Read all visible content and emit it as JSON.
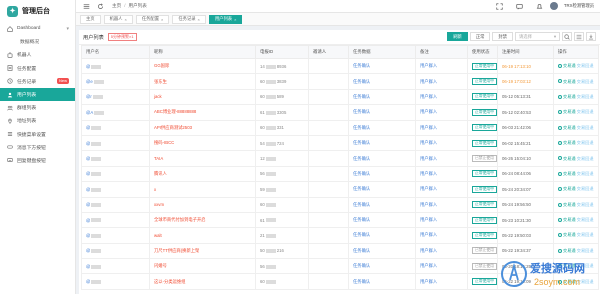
{
  "app": {
    "title": "管理后台",
    "logo_glyph": "✦"
  },
  "sidebar": {
    "items": [
      {
        "label": "Dashboard",
        "icon": "home-icon",
        "caret": "▾",
        "type": "parent"
      },
      {
        "label": "数据概况",
        "icon": "",
        "type": "sub"
      },
      {
        "label": "机器人",
        "icon": "robot-icon",
        "type": "item"
      },
      {
        "label": "任务配置",
        "icon": "task-icon",
        "type": "item"
      },
      {
        "label": "任务记录",
        "icon": "record-icon",
        "badge": "New",
        "type": "item"
      },
      {
        "label": "用户列表",
        "icon": "user-icon",
        "type": "active"
      },
      {
        "label": "群组列表",
        "icon": "group-icon",
        "type": "item"
      },
      {
        "label": "地址列表",
        "icon": "address-icon",
        "type": "item"
      },
      {
        "label": "快捷菜单设置",
        "icon": "menu-icon",
        "type": "item"
      },
      {
        "label": "消息下方按钮",
        "icon": "button-icon",
        "type": "item"
      },
      {
        "label": "回复键盘按钮",
        "icon": "keyboard-icon",
        "type": "item"
      }
    ]
  },
  "topbar": {
    "breadcrumb": [
      "主页",
      "用户列表"
    ],
    "user": "TRX检测管理员",
    "icons": [
      "menu-icon",
      "refresh-icon",
      "fullscreen-icon",
      "message-icon",
      "bell-icon"
    ]
  },
  "tabs": [
    {
      "label": "主页",
      "active": false
    },
    {
      "label": "机器人",
      "active": false
    },
    {
      "label": "任务配置",
      "active": false
    },
    {
      "label": "任务记录",
      "active": false
    },
    {
      "label": "用户列表",
      "active": true
    }
  ],
  "toolbar": {
    "title": "用户列表",
    "tip": "5分钟预警×1",
    "buttons": [
      "刷新",
      "正常",
      "封禁"
    ],
    "select_placeholder": "请选择"
  },
  "table": {
    "columns": [
      "用户名",
      "昵称",
      "电报ID",
      "邀请人",
      "任务数据",
      "备注",
      "使用状态",
      "注册时间",
      "操作"
    ],
    "rows": [
      {
        "user": "@",
        "nick": "GG国际",
        "tid": "14",
        "tid2": "8936",
        "task": "任务确认",
        "note": "用户群入",
        "status": "正常使用中",
        "time": "06-19 17:13:10",
        "time_hl": true
      },
      {
        "user": "@e",
        "nick": "张东生",
        "tid": "60",
        "tid2": "3839",
        "task": "任务确认",
        "note": "用户群入",
        "status": "正常使用中",
        "time": "06-19 17:03:12",
        "time_hl": true
      },
      {
        "user": "@r",
        "nick": "jack",
        "tid": "60",
        "tid2": "589",
        "task": "任务确认",
        "note": "用户群入",
        "status": "正常使用中",
        "time": "05-12 05:13:31",
        "time_hl": false
      },
      {
        "user": "@A",
        "nick": "ABC博业理-88888888",
        "tid": "61",
        "tid2": "3305",
        "task": "任务确认",
        "note": "用户群入",
        "status": "正常使用中",
        "time": "05-12 02:40:53",
        "time_hl": false
      },
      {
        "user": "@",
        "nick": "API供应商测试2503",
        "tid": "60",
        "tid2": "331",
        "task": "任务确认",
        "note": "用户群入",
        "status": "正常使用中",
        "time": "06-03 21:42:06",
        "time_hl": false
      },
      {
        "user": "@",
        "nick": "搜码-IBCC",
        "tid": "54",
        "tid2": "724",
        "task": "任务确认",
        "note": "用户群入",
        "status": "正常使用中",
        "time": "06-02 15:45:21",
        "time_hl": false
      },
      {
        "user": "@",
        "nick": "TAIA",
        "tid": "12",
        "tid2": "",
        "task": "任务确认",
        "note": "用户群入",
        "status": "已禁止使用",
        "time": "06-26 15:04:10",
        "time_hl": false
      },
      {
        "user": "@",
        "nick": "腾讯人",
        "tid": "56",
        "tid2": "",
        "task": "任务确认",
        "note": "用户群入",
        "status": "正常使用中",
        "time": "06-24 08:44:06",
        "time_hl": false
      },
      {
        "user": "@",
        "nick": "x",
        "tid": "59",
        "tid2": "",
        "task": "任务确认",
        "note": "用户群入",
        "status": "正常使用中",
        "time": "05-24 20:34:07",
        "time_hl": false
      },
      {
        "user": "@",
        "nick": "xxvm",
        "tid": "60",
        "tid2": "",
        "task": "任务确认",
        "note": "用户群入",
        "status": "正常使用中",
        "time": "05-24 19:56:50",
        "time_hl": false
      },
      {
        "user": "@",
        "nick": "全球币商代付加到电子开启",
        "tid": "61",
        "tid2": "",
        "task": "任务确认",
        "note": "用户群入",
        "status": "正常使用中",
        "time": "05-23 10:21:30",
        "time_hl": false
      },
      {
        "user": "@",
        "nick": "walt",
        "tid": "21",
        "tid2": "",
        "task": "任务确认",
        "note": "用户群入",
        "status": "正常使用中",
        "time": "05-22 19:50:03",
        "time_hl": false
      },
      {
        "user": "@",
        "nick": "刀尺TT供应商(换新上架",
        "tid": "50",
        "tid2": "216",
        "task": "任务确认",
        "note": "用户群入",
        "status": "已禁止使用",
        "time": "05-22 19:34:37",
        "time_hl": false
      },
      {
        "user": "@",
        "nick": "闪婚号",
        "tid": "56",
        "tid2": "",
        "task": "任务确认",
        "note": "用户群入",
        "status": "已禁止使用",
        "time": "05-20 18:15:25",
        "time_hl": false
      },
      {
        "user": "@",
        "nick": "这以-分类运维组",
        "tid": "60",
        "tid2": "",
        "task": "任务确认",
        "note": "用户群入",
        "status": "正常使用中",
        "time": "05-22 19:10:09",
        "time_hl": false
      }
    ],
    "ops": [
      "交易通",
      "交易回退"
    ]
  },
  "watermark": {
    "line1": "爱搜源码网",
    "line2": "2soym.com"
  }
}
